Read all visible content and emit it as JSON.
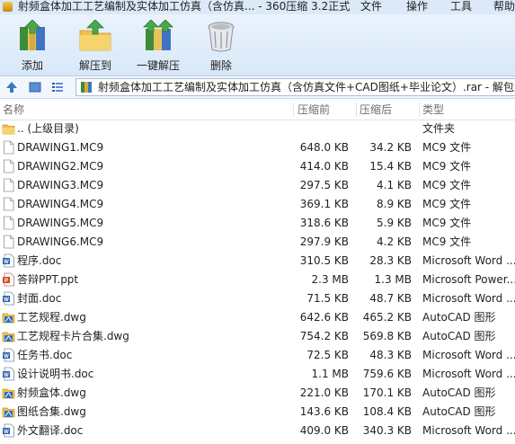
{
  "titlebar": {
    "title": "射频盒体加工工艺编制及实体加工仿真（含仿真... - 360压缩 3.2正式版",
    "menus": [
      "文件",
      "操作",
      "工具",
      "帮助"
    ]
  },
  "toolbar": {
    "buttons": [
      {
        "label": "添加",
        "icon": "add-archive-icon"
      },
      {
        "label": "解压到",
        "icon": "extract-to-folder-icon"
      },
      {
        "label": "一键解压",
        "icon": "one-click-extract-icon"
      },
      {
        "label": "删除",
        "icon": "trash-bin-icon"
      }
    ]
  },
  "addressbar": {
    "path": "射频盒体加工工艺编制及实体加工仿真（含仿真文件+CAD图纸+毕业论文）.rar - 解包大"
  },
  "columns": {
    "name": "名称",
    "size": "压缩前",
    "compressed": "压缩后",
    "type": "类型"
  },
  "files": [
    {
      "name": ".. (上级目录)",
      "size": "",
      "compressed": "",
      "type": "文件夹",
      "icon": "folder-up-icon"
    },
    {
      "name": "DRAWING1.MC9",
      "size": "648.0 KB",
      "compressed": "34.2 KB",
      "type": "MC9 文件",
      "icon": "blank-file-icon"
    },
    {
      "name": "DRAWING2.MC9",
      "size": "414.0 KB",
      "compressed": "15.4 KB",
      "type": "MC9 文件",
      "icon": "blank-file-icon"
    },
    {
      "name": "DRAWING3.MC9",
      "size": "297.5 KB",
      "compressed": "4.1 KB",
      "type": "MC9 文件",
      "icon": "blank-file-icon"
    },
    {
      "name": "DRAWING4.MC9",
      "size": "369.1 KB",
      "compressed": "8.9 KB",
      "type": "MC9 文件",
      "icon": "blank-file-icon"
    },
    {
      "name": "DRAWING5.MC9",
      "size": "318.6 KB",
      "compressed": "5.9 KB",
      "type": "MC9 文件",
      "icon": "blank-file-icon"
    },
    {
      "name": "DRAWING6.MC9",
      "size": "297.9 KB",
      "compressed": "4.2 KB",
      "type": "MC9 文件",
      "icon": "blank-file-icon"
    },
    {
      "name": "程序.doc",
      "size": "310.5 KB",
      "compressed": "28.3 KB",
      "type": "Microsoft Word ...",
      "icon": "word-doc-icon"
    },
    {
      "name": "答辩PPT.ppt",
      "size": "2.3 MB",
      "compressed": "1.3 MB",
      "type": "Microsoft Power...",
      "icon": "powerpoint-icon"
    },
    {
      "name": "封面.doc",
      "size": "71.5 KB",
      "compressed": "48.7 KB",
      "type": "Microsoft Word ...",
      "icon": "word-doc-icon"
    },
    {
      "name": "工艺规程.dwg",
      "size": "642.6 KB",
      "compressed": "465.2 KB",
      "type": "AutoCAD 图形",
      "icon": "autocad-dwg-icon"
    },
    {
      "name": "工艺规程卡片合集.dwg",
      "size": "754.2 KB",
      "compressed": "569.8 KB",
      "type": "AutoCAD 图形",
      "icon": "autocad-dwg-icon"
    },
    {
      "name": "任务书.doc",
      "size": "72.5 KB",
      "compressed": "48.3 KB",
      "type": "Microsoft Word ...",
      "icon": "word-doc-icon"
    },
    {
      "name": "设计说明书.doc",
      "size": "1.1 MB",
      "compressed": "759.6 KB",
      "type": "Microsoft Word ...",
      "icon": "word-doc-icon"
    },
    {
      "name": "射频盒体.dwg",
      "size": "221.0 KB",
      "compressed": "170.1 KB",
      "type": "AutoCAD 图形",
      "icon": "autocad-dwg-icon"
    },
    {
      "name": "图纸合集.dwg",
      "size": "143.6 KB",
      "compressed": "108.4 KB",
      "type": "AutoCAD 图形",
      "icon": "autocad-dwg-icon"
    },
    {
      "name": "外文翻译.doc",
      "size": "409.0 KB",
      "compressed": "340.3 KB",
      "type": "Microsoft Word ...",
      "icon": "word-doc-icon"
    }
  ],
  "colors": {
    "toolbar_bg": "#dde9f7",
    "header_text": "#6d6d6d",
    "folder": "#f2c04a",
    "word": "#2b5fb4",
    "powerpoint": "#d04a23",
    "autocad": "#2a6fc0"
  }
}
